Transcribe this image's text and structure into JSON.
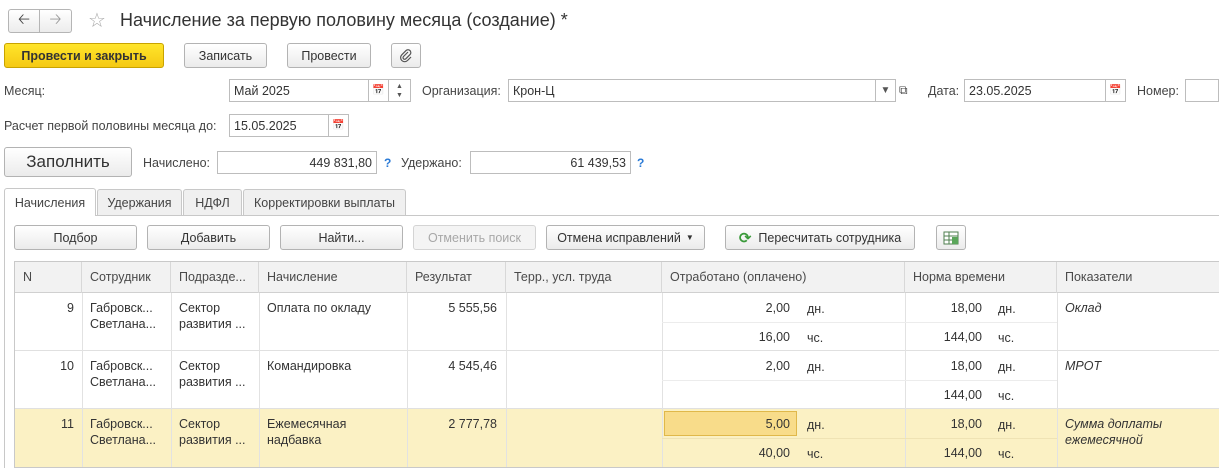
{
  "window": {
    "title": "Начисление за первую половину месяца (создание) *"
  },
  "icons": {
    "back": "arrow-left-icon",
    "forward": "arrow-right-icon",
    "favorite": "star-icon",
    "attach": "paperclip-icon",
    "calendar": "calendar-icon",
    "refresh": "refresh-icon",
    "grid_settings": "grid-settings-icon"
  },
  "colors": {
    "primary_button": "#f5c914",
    "selected_row": "#fbf1c4",
    "highlight_cell": "#f8dc8a",
    "help": "#2a7ad6",
    "refresh_icon": "#3a9a3a"
  },
  "toolbar": {
    "post_close": "Провести и закрыть",
    "save": "Записать",
    "post": "Провести"
  },
  "form": {
    "month_label": "Месяц:",
    "month_value": "Май 2025",
    "org_label": "Организация:",
    "org_value": "Крон-Ц",
    "date_label": "Дата:",
    "date_value": "23.05.2025",
    "number_label": "Номер:",
    "number_value": "",
    "calc_until_label": "Расчет первой половины месяца до:",
    "calc_until_value": "15.05.2025",
    "fill_button": "Заполнить",
    "accrued_label": "Начислено:",
    "accrued_value": "449 831,80",
    "withheld_label": "Удержано:",
    "withheld_value": "61 439,53",
    "help_mark": "?"
  },
  "tabs": [
    "Начисления",
    "Удержания",
    "НДФЛ",
    "Корректировки выплаты"
  ],
  "grid_toolbar": {
    "select": "Подбор",
    "add": "Добавить",
    "find": "Найти...",
    "cancel_search": "Отменить поиск",
    "cancel_corrections": "Отмена исправлений",
    "recalc": "Пересчитать сотрудника"
  },
  "table": {
    "columns": [
      "N",
      "Сотрудник",
      "Подразде...",
      "Начисление",
      "Результат",
      "Терр., усл. труда",
      "Отработано (оплачено)",
      "Норма времени",
      "Показатели"
    ],
    "rows": [
      {
        "n": "9",
        "employee": [
          "Габровск...",
          "Светлана..."
        ],
        "dept": [
          "Сектор",
          "развития ..."
        ],
        "accrual": [
          "Оплата по окладу"
        ],
        "result": "5 555,56",
        "worked1": "2,00",
        "worked1_unit": "дн.",
        "worked2": "16,00",
        "worked2_unit": "чс.",
        "norm1": "18,00",
        "norm1_unit": "дн.",
        "norm2": "144,00",
        "norm2_unit": "чс.",
        "indicator": [
          "Оклад"
        ]
      },
      {
        "n": "10",
        "employee": [
          "Габровск...",
          "Светлана..."
        ],
        "dept": [
          "Сектор",
          "развития ..."
        ],
        "accrual": [
          "Командировка"
        ],
        "result": "4 545,46",
        "worked1": "2,00",
        "worked1_unit": "дн.",
        "worked2": "",
        "worked2_unit": "",
        "norm1": "18,00",
        "norm1_unit": "дн.",
        "norm2": "144,00",
        "norm2_unit": "чс.",
        "indicator": [
          "МРОТ"
        ]
      },
      {
        "n": "11",
        "employee": [
          "Габровск...",
          "Светлана..."
        ],
        "dept": [
          "Сектор",
          "развития ..."
        ],
        "accrual": [
          "Ежемесячная",
          "надбавка"
        ],
        "result": "2 777,78",
        "worked1": "5,00",
        "worked1_unit": "дн.",
        "worked2": "40,00",
        "worked2_unit": "чс.",
        "norm1": "18,00",
        "norm1_unit": "дн.",
        "norm2": "144,00",
        "norm2_unit": "чс.",
        "indicator": [
          "Сумма доплаты",
          "ежемесячной"
        ]
      }
    ]
  }
}
